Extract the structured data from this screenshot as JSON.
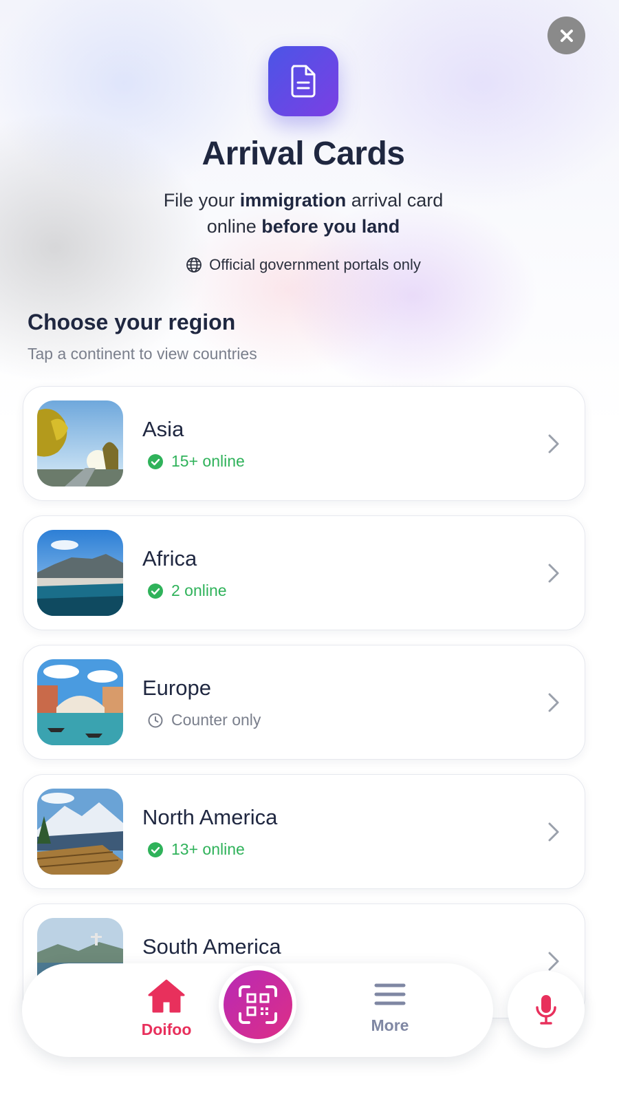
{
  "header": {
    "title": "Arrival Cards",
    "subtitle_part1": "File your ",
    "subtitle_bold1": "immigration",
    "subtitle_part2": " arrival card",
    "subtitle_part3": "online ",
    "subtitle_bold2": "before you land",
    "official_note": "Official government portals only",
    "app_icon": "document-icon",
    "close_icon": "close-icon"
  },
  "section": {
    "title": "Choose your region",
    "subtitle": "Tap a continent to view countries"
  },
  "regions": [
    {
      "name": "Asia",
      "status": "15+ online",
      "status_type": "online",
      "status_icon": "check-circle-icon"
    },
    {
      "name": "Africa",
      "status": "2 online",
      "status_type": "online",
      "status_icon": "check-circle-icon"
    },
    {
      "name": "Europe",
      "status": "Counter only",
      "status_type": "counter",
      "status_icon": "clock-icon"
    },
    {
      "name": "North America",
      "status": "13+ online",
      "status_type": "online",
      "status_icon": "check-circle-icon"
    },
    {
      "name": "South America"
    }
  ],
  "bottom_nav": {
    "home_label": "Doifoo",
    "more_label": "More",
    "home_icon": "home-icon",
    "scan_icon": "qr-scan-icon",
    "more_icon": "menu-icon",
    "mic_icon": "microphone-icon"
  },
  "colors": {
    "accent": "#e8305c",
    "online_green": "#2fb25a",
    "app_icon_gradient": [
      "#4b55e6",
      "#7b3fe4"
    ],
    "scan_gradient": [
      "#b82ab5",
      "#dd2e86"
    ],
    "title_text": "#1f2740"
  }
}
